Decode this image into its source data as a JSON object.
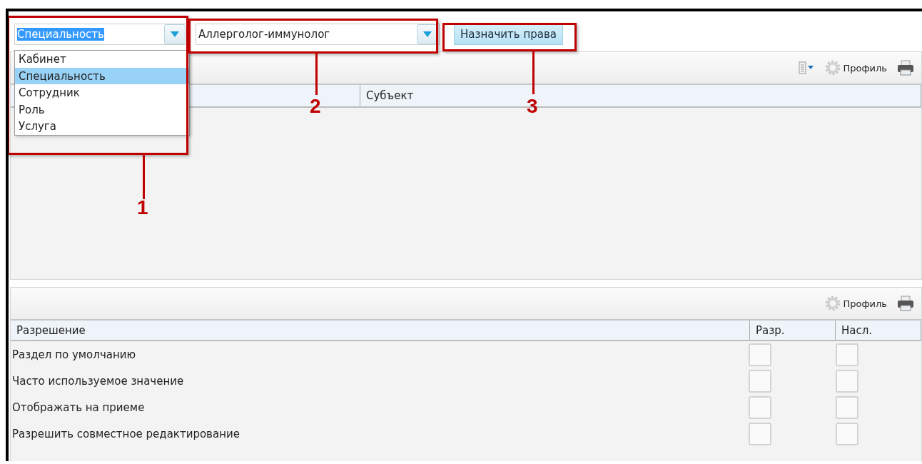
{
  "toolbar": {
    "type_combo": {
      "value": "Специальность",
      "options": [
        {
          "label": "Кабинет",
          "selected": false
        },
        {
          "label": "Специальность",
          "selected": true
        },
        {
          "label": "Сотрудник",
          "selected": false
        },
        {
          "label": "Роль",
          "selected": false
        },
        {
          "label": "Услуга",
          "selected": false
        }
      ]
    },
    "subject_combo": {
      "value": "Аллерголог-иммунолог"
    },
    "assign_button": "Назначить права"
  },
  "subjects_panel": {
    "toolbar": {
      "profile_label": "Профиль"
    },
    "columns": [
      "",
      "Субъект"
    ]
  },
  "permissions_panel": {
    "toolbar": {
      "profile_label": "Профиль"
    },
    "columns": [
      "Разрешение",
      "Разр.",
      "Насл."
    ],
    "rows": [
      {
        "label": "Раздел по умолчанию",
        "allowed": false,
        "inherited": false
      },
      {
        "label": "Часто используемое значение",
        "allowed": false,
        "inherited": false
      },
      {
        "label": "Отображать на приеме",
        "allowed": false,
        "inherited": false
      },
      {
        "label": "Разрешить совместное редактирование",
        "allowed": false,
        "inherited": false
      }
    ]
  },
  "callouts": [
    {
      "number": "1"
    },
    {
      "number": "2"
    },
    {
      "number": "3"
    }
  ]
}
